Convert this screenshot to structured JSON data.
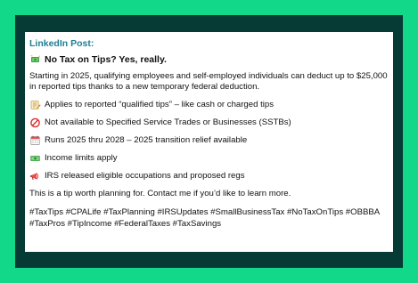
{
  "post": {
    "title": "LinkedIn Post:",
    "headline": "No Tax on Tips? Yes, really.",
    "paragraph": "Starting in 2025, qualifying employees and self-employed individuals can deduct up to $25,000 in reported tips thanks to a new temporary federal deduction.",
    "items": [
      {
        "text": "Applies to reported “qualified tips” – like cash or charged tips",
        "icon": "memo-icon"
      },
      {
        "text": "Not available to Specified Service Trades or Businesses (SSTBs)",
        "icon": "prohibited-icon"
      },
      {
        "text": "Runs 2025 thru 2028 – 2025 transition relief available",
        "icon": "calendar-icon"
      },
      {
        "text": "Income limits apply",
        "icon": "money-icon"
      },
      {
        "text": "IRS released eligible occupations and proposed regs",
        "icon": "megaphone-icon"
      }
    ],
    "cta": "This is a tip worth planning for. Contact me if you’d like to learn more.",
    "hashtags": "#TaxTips #CPALife #TaxPlanning #IRSUpdates #SmallBusinessTax #NoTaxOnTips #OBBBA #TaxPros #TipIncome #FederalTaxes #TaxSavings"
  },
  "colors": {
    "outer_background": "#12d98a",
    "panel_background": "#063a35",
    "card_background": "#ffffff",
    "title_color": "#1d7f93",
    "text_color": "#111111"
  }
}
